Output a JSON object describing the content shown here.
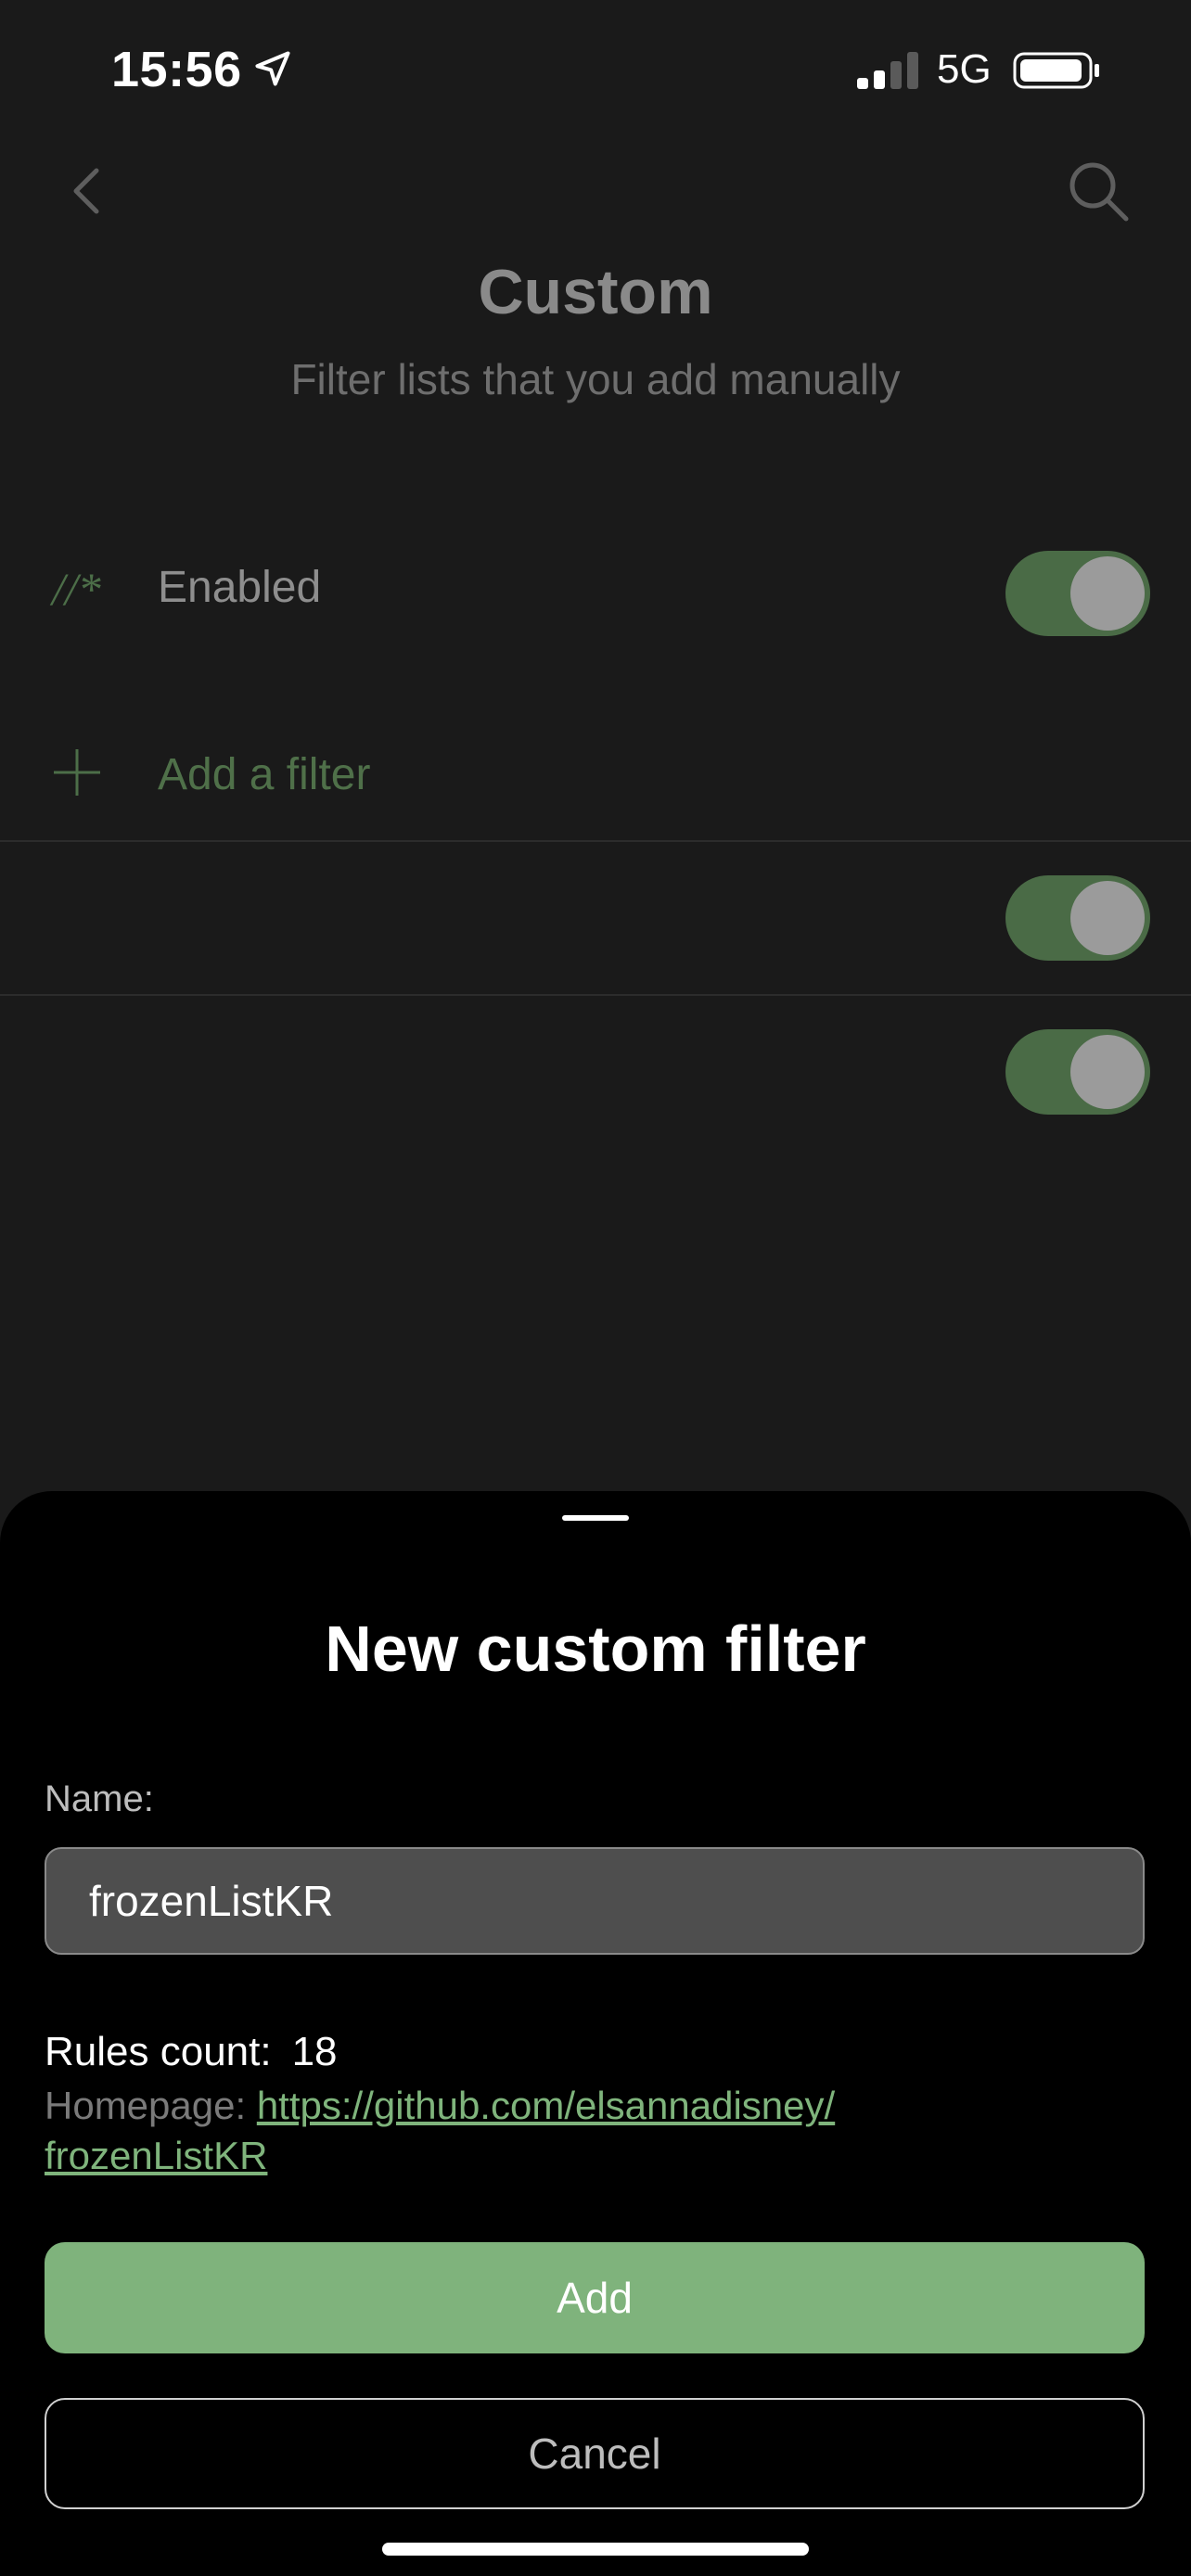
{
  "status_bar": {
    "time": "15:56",
    "network": "5G",
    "icons": [
      "location-arrow-icon",
      "cellular-signal-icon",
      "battery-icon"
    ]
  },
  "header": {
    "title": "Custom",
    "subtitle": "Filter lists that you add manually",
    "icons": [
      "chevron-left-icon",
      "search-icon"
    ]
  },
  "list": {
    "enabled_glyph": "//*",
    "enabled_label": "Enabled",
    "enabled_on": true,
    "add_filter_label": "Add a filter",
    "filter_rows": [
      {
        "enabled": true
      },
      {
        "enabled": true
      }
    ]
  },
  "sheet": {
    "title": "New custom filter",
    "name_label": "Name:",
    "name_value": "frozenListKR",
    "rules_count_label": "Rules count:",
    "rules_count_value": "18",
    "homepage_label": "Homepage:",
    "homepage_url": "https://github.com/elsannadisney/frozenListKR",
    "homepage_url_line1": "https://github.com/elsannadisney/",
    "homepage_url_line2": "frozenListKR",
    "add_label": "Add",
    "cancel_label": "Cancel"
  },
  "colors": {
    "accent": "#7fb37c",
    "sheet_background": "#000000",
    "background": "#1a1a1a"
  }
}
